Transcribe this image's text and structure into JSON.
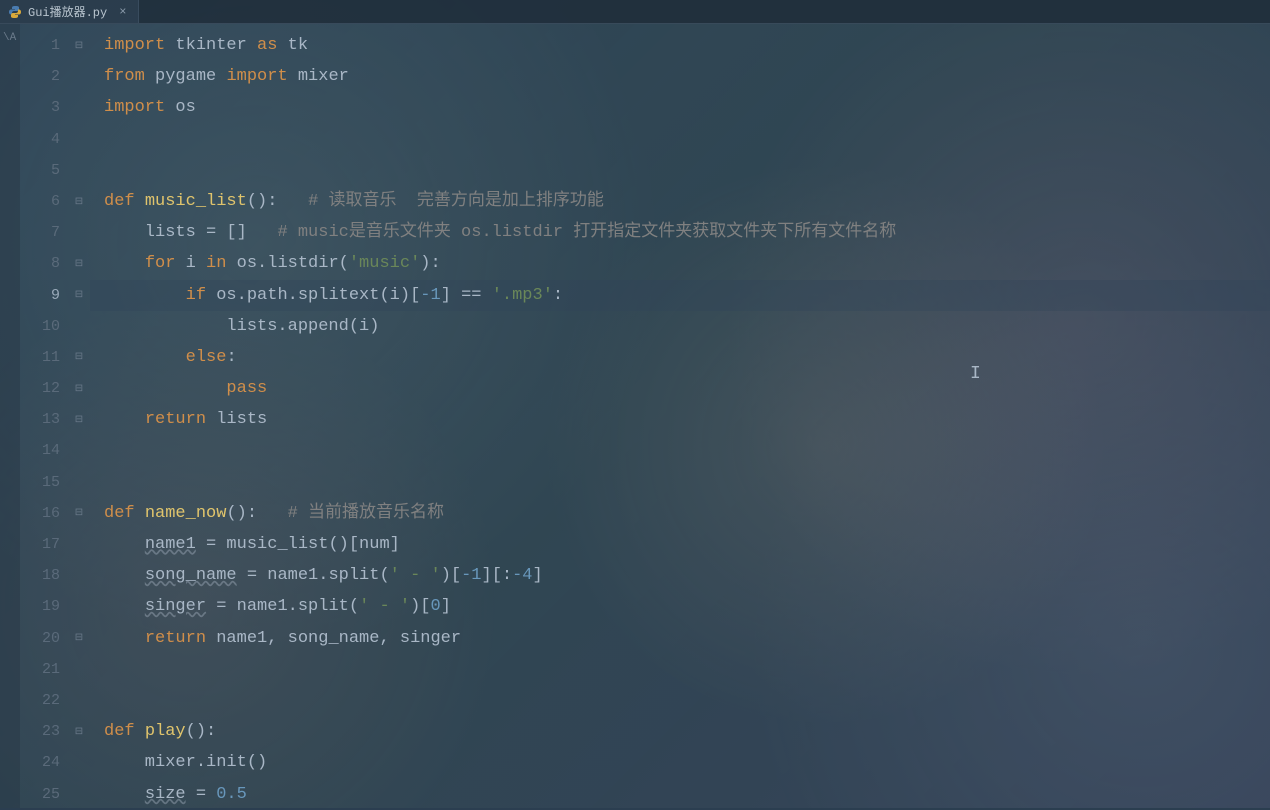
{
  "tab": {
    "filename": "Gui播放器.py"
  },
  "gutter": {
    "left_label": "\\A",
    "line_numbers": [
      1,
      2,
      3,
      4,
      5,
      6,
      7,
      8,
      9,
      10,
      11,
      12,
      13,
      14,
      15,
      16,
      17,
      18,
      19,
      20,
      21,
      22,
      23,
      24,
      25
    ],
    "current_line": 9,
    "fold_markers": {
      "1": "⊟",
      "6": "⊟",
      "8": "⊟",
      "9": "⊟",
      "11": "⊟",
      "12": "⊟",
      "13": "⊟",
      "16": "⊟",
      "20": "⊟",
      "23": "⊟"
    }
  },
  "code": [
    {
      "t": [
        [
          "kw",
          "import"
        ],
        [
          "op",
          " tkinter "
        ],
        [
          "kw",
          "as"
        ],
        [
          "op",
          " tk"
        ]
      ]
    },
    {
      "t": [
        [
          "kw",
          "from"
        ],
        [
          "op",
          " pygame "
        ],
        [
          "kw",
          "import"
        ],
        [
          "op",
          " mixer"
        ]
      ]
    },
    {
      "t": [
        [
          "kw",
          "import"
        ],
        [
          "op",
          " os"
        ]
      ]
    },
    {
      "t": []
    },
    {
      "t": []
    },
    {
      "t": [
        [
          "kw",
          "def "
        ],
        [
          "fn",
          "music_list"
        ],
        [
          "op",
          "():   "
        ],
        [
          "cm",
          "# 读取音乐  完善方向是加上排序功能"
        ]
      ]
    },
    {
      "t": [
        [
          "op",
          "    lists = []   "
        ],
        [
          "cm",
          "# music是音乐文件夹 os.listdir 打开指定文件夹获取文件夹下所有文件名称"
        ]
      ]
    },
    {
      "t": [
        [
          "op",
          "    "
        ],
        [
          "kw",
          "for"
        ],
        [
          "op",
          " i "
        ],
        [
          "kw",
          "in"
        ],
        [
          "op",
          " os.listdir("
        ],
        [
          "str",
          "'music'"
        ],
        [
          "op",
          "):"
        ]
      ]
    },
    {
      "t": [
        [
          "op",
          "        "
        ],
        [
          "kw",
          "if"
        ],
        [
          "op",
          " os.path.splitext(i)["
        ],
        [
          "num",
          "-1"
        ],
        [
          "op",
          "] == "
        ],
        [
          "str",
          "'.mp3'"
        ],
        [
          "op",
          ":"
        ]
      ],
      "current": true
    },
    {
      "t": [
        [
          "op",
          "            lists.append(i)"
        ]
      ]
    },
    {
      "t": [
        [
          "op",
          "        "
        ],
        [
          "kw",
          "else"
        ],
        [
          "op",
          ":"
        ]
      ]
    },
    {
      "t": [
        [
          "op",
          "            "
        ],
        [
          "kw",
          "pass"
        ]
      ]
    },
    {
      "t": [
        [
          "op",
          "    "
        ],
        [
          "kw",
          "return"
        ],
        [
          "op",
          " lists"
        ]
      ]
    },
    {
      "t": []
    },
    {
      "t": []
    },
    {
      "t": [
        [
          "kw",
          "def "
        ],
        [
          "fn",
          "name_now"
        ],
        [
          "op",
          "():   "
        ],
        [
          "cm",
          "# 当前播放音乐名称"
        ]
      ]
    },
    {
      "t": [
        [
          "op",
          "    "
        ],
        [
          "und",
          "name1"
        ],
        [
          "op",
          " = music_list()[num]"
        ]
      ]
    },
    {
      "t": [
        [
          "op",
          "    "
        ],
        [
          "und",
          "song_name"
        ],
        [
          "op",
          " = name1.split("
        ],
        [
          "str",
          "' - '"
        ],
        [
          "op",
          ")["
        ],
        [
          "num",
          "-1"
        ],
        [
          "op",
          "][:"
        ],
        [
          "num",
          "-4"
        ],
        [
          "op",
          "]"
        ]
      ]
    },
    {
      "t": [
        [
          "op",
          "    "
        ],
        [
          "und",
          "singer"
        ],
        [
          "op",
          " = name1.split("
        ],
        [
          "str",
          "' - '"
        ],
        [
          "op",
          ")["
        ],
        [
          "num",
          "0"
        ],
        [
          "op",
          "]"
        ]
      ]
    },
    {
      "t": [
        [
          "op",
          "    "
        ],
        [
          "kw",
          "return"
        ],
        [
          "op",
          " name1, song_name, singer"
        ]
      ]
    },
    {
      "t": []
    },
    {
      "t": []
    },
    {
      "t": [
        [
          "kw",
          "def "
        ],
        [
          "fn",
          "play"
        ],
        [
          "op",
          "():"
        ]
      ]
    },
    {
      "t": [
        [
          "op",
          "    mixer.init()"
        ]
      ]
    },
    {
      "t": [
        [
          "op",
          "    "
        ],
        [
          "und",
          "size"
        ],
        [
          "op",
          " = "
        ],
        [
          "num",
          "0.5"
        ]
      ]
    }
  ]
}
